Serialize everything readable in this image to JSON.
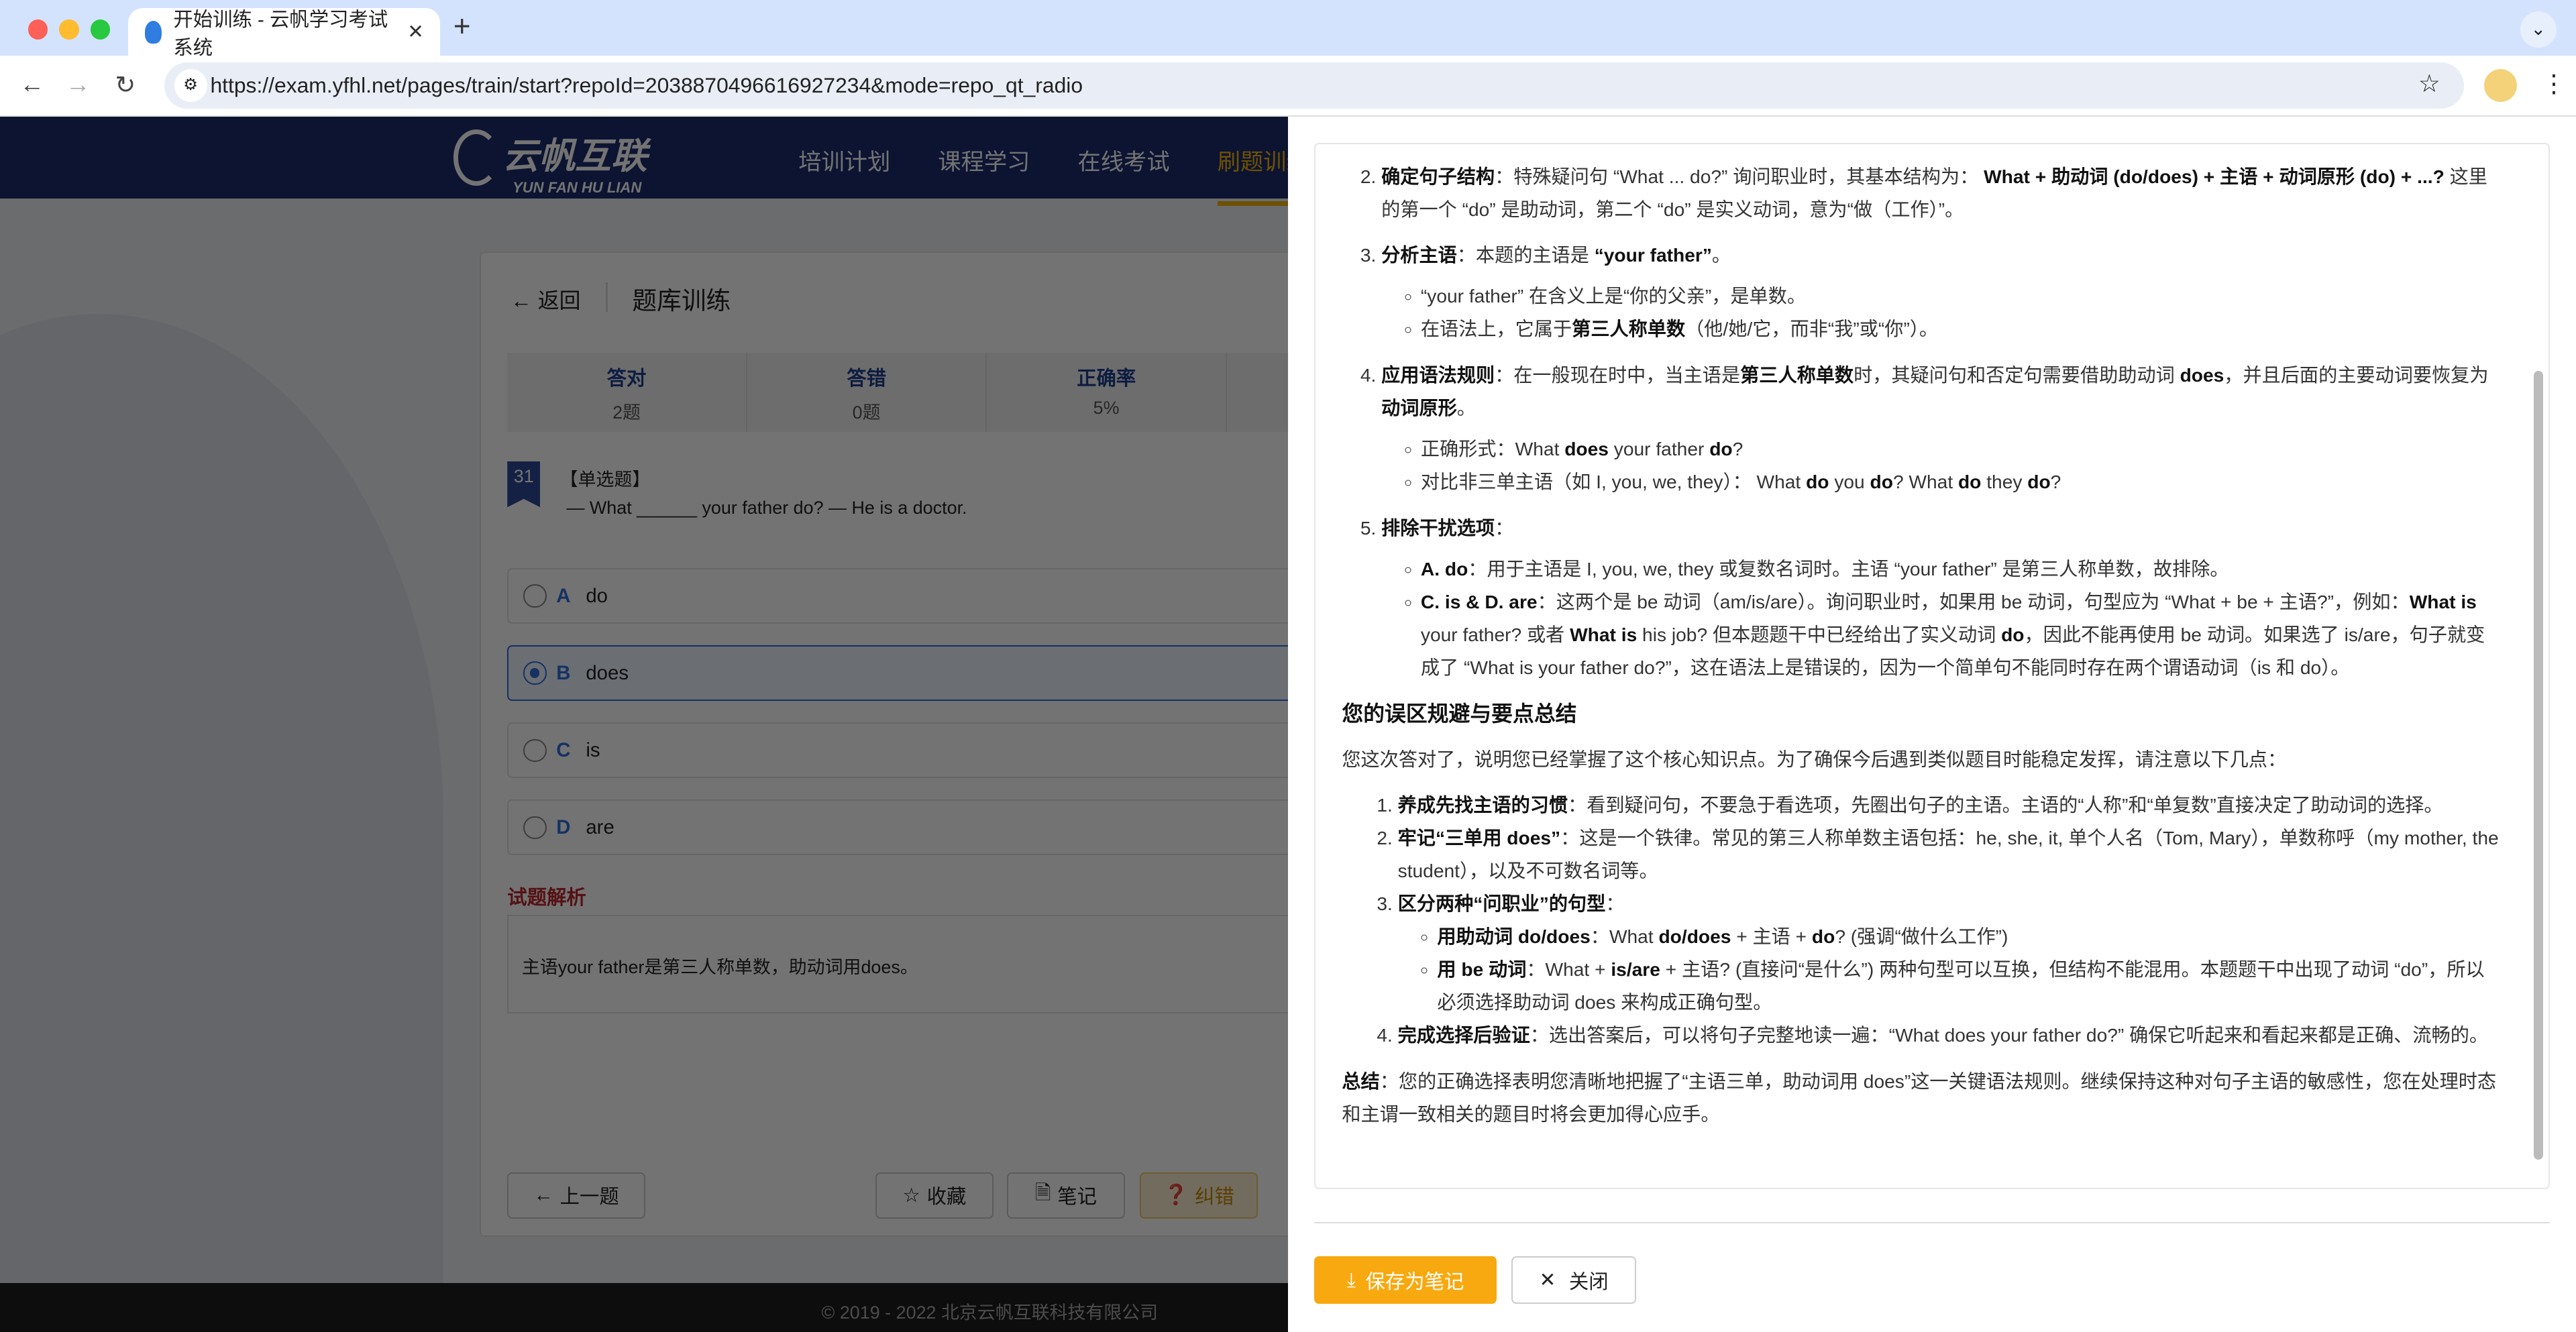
{
  "browser": {
    "tab_title": "开始训练 - 云帆学习考试系统",
    "url": "https://exam.yfhl.net/pages/train/start?repoId=2038870496616927234&mode=repo_qt_radio"
  },
  "site": {
    "logo_cn": "云帆互联",
    "logo_en": "YUN FAN HU LIAN",
    "nav": [
      "培训计划",
      "课程学习",
      "在线考试",
      "刷题训练"
    ],
    "active_nav": "刷题训练"
  },
  "train": {
    "back": "返回",
    "title": "题库训练",
    "stats": [
      {
        "label": "答对",
        "value": "2题"
      },
      {
        "label": "答错",
        "value": "0题"
      },
      {
        "label": "正确率",
        "value": "5%"
      }
    ],
    "question_number": "31",
    "question_type": "【单选题】",
    "question_text": "— What ______ your father do? — He is a doctor.",
    "options": [
      {
        "letter": "A",
        "text": "do",
        "selected": false
      },
      {
        "letter": "B",
        "text": "does",
        "selected": true
      },
      {
        "letter": "C",
        "text": "is",
        "selected": false
      },
      {
        "letter": "D",
        "text": "are",
        "selected": false
      }
    ],
    "analysis_label": "试题解析",
    "analysis_text": "主语your father是第三人称单数，助动词用does。",
    "buttons": {
      "prev": "上一题",
      "favorite": "收藏",
      "note": "笔记",
      "report": "纠错"
    }
  },
  "footer": {
    "text": "© 2019 - 2022 北京云帆互联科技有限公司"
  },
  "drawer": {
    "steps": [
      {
        "n": 2,
        "segs": [
          {
            "b": "确定句子结构"
          },
          "：特殊疑问句 “What ... do?” 询问职业时，其基本结构为： ",
          {
            "b": "What + 助动词 (do/does) + 主语 + 动词原形 (do) + ...?"
          },
          " 这里的第一个 “do” 是助动词，第二个 “do” 是实义动词，意为“做（工作）”。"
        ],
        "subs": []
      },
      {
        "n": 3,
        "segs": [
          {
            "b": "分析主语"
          },
          "：本题的主语是 ",
          {
            "b": "“your father”"
          },
          "。"
        ],
        "subs": [
          [
            "“your father” 在含义上是“你的父亲”，是单数。"
          ],
          [
            "在语法上，它属于",
            {
              "b": "第三人称单数"
            },
            "（他/她/它，而非“我”或“你”）。"
          ]
        ]
      },
      {
        "n": 4,
        "segs": [
          {
            "b": "应用语法规则"
          },
          "：在一般现在时中，当主语是",
          {
            "b": "第三人称单数"
          },
          "时，其疑问句和否定句需要借助助动词 ",
          {
            "b": "does"
          },
          "，并且后面的主要动词要恢复为",
          {
            "b": "动词原形"
          },
          "。"
        ],
        "subs": [
          [
            "正确形式：What ",
            {
              "b": "does"
            },
            " your father ",
            {
              "b": "do"
            },
            "?"
          ],
          [
            "对比非三单主语（如 I, you, we, they）： What ",
            {
              "b": "do"
            },
            " you ",
            {
              "b": "do"
            },
            "? What ",
            {
              "b": "do"
            },
            " they ",
            {
              "b": "do"
            },
            "?"
          ]
        ]
      },
      {
        "n": 5,
        "segs": [
          {
            "b": "排除干扰选项"
          },
          "："
        ],
        "subs": [
          [
            {
              "b": "A. do"
            },
            "：用于主语是 I, you, we, they 或复数名词时。主语 “your father” 是第三人称单数，故排除。"
          ],
          [
            {
              "b": "C. is & D. are"
            },
            "：这两个是 be 动词（am/is/are）。询问职业时，如果用 be 动词，句型应为 “What + be + 主语?”，例如：",
            {
              "b": "What is"
            },
            " your father? 或者 ",
            {
              "b": "What is"
            },
            " his job? 但本题题干中已经给出了实义动词 ",
            {
              "b": "do"
            },
            "，因此不能再使用 be 动词。如果选了 is/are，句子就变成了 “What is your father do?”，这在语法上是错误的，因为一个简单句不能同时存在两个谓语动词（is 和 do）。"
          ]
        ]
      }
    ],
    "heading": "您的误区规避与要点总结",
    "intro": "您这次答对了，说明您已经掌握了这个核心知识点。为了确保今后遇到类似题目时能稳定发挥，请注意以下几点：",
    "tips": [
      {
        "segs": [
          {
            "b": "养成先找主语的习惯"
          },
          "：看到疑问句，不要急于看选项，先圈出句子的主语。主语的“人称”和“单复数”直接决定了助动词的选择。"
        ],
        "subs": []
      },
      {
        "segs": [
          {
            "b": "牢记“三单用 does”"
          },
          "：这是一个铁律。常见的第三人称单数主语包括：he, she, it, 单个人名（Tom, Mary），单数称呼（my mother, the student），以及不可数名词等。"
        ],
        "subs": []
      },
      {
        "segs": [
          {
            "b": "区分两种“问职业”的句型"
          },
          "："
        ],
        "subs": [
          [
            {
              "b": "用助动词 do/does"
            },
            "：What ",
            {
              "b": "do/does"
            },
            " + 主语 + ",
            {
              "b": "do"
            },
            "? (强调“做什么工作”)"
          ],
          [
            {
              "b": "用 be 动词"
            },
            "：What + ",
            {
              "b": "is/are"
            },
            " + 主语? (直接问“是什么”) 两种句型可以互换，但结构不能混用。本题题干中出现了动词 “do”，所以必须选择助动词 does 来构成正确句型。"
          ]
        ]
      },
      {
        "segs": [
          {
            "b": "完成选择后验证"
          },
          "：选出答案后，可以将句子完整地读一遍：“What does your father do?” 确保它听起来和看起来都是正确、流畅的。"
        ],
        "subs": []
      }
    ],
    "summary": [
      {
        "b": "总结"
      },
      "：您的正确选择表明您清晰地把握了“主语三单，助动词用 does”这一关键语法规则。继续保持这种对句子主语的敏感性，您在处理时态和主谓一致相关的题目时将会更加得心应手。"
    ],
    "save_label": "保存为笔记",
    "close_label": "关闭"
  }
}
